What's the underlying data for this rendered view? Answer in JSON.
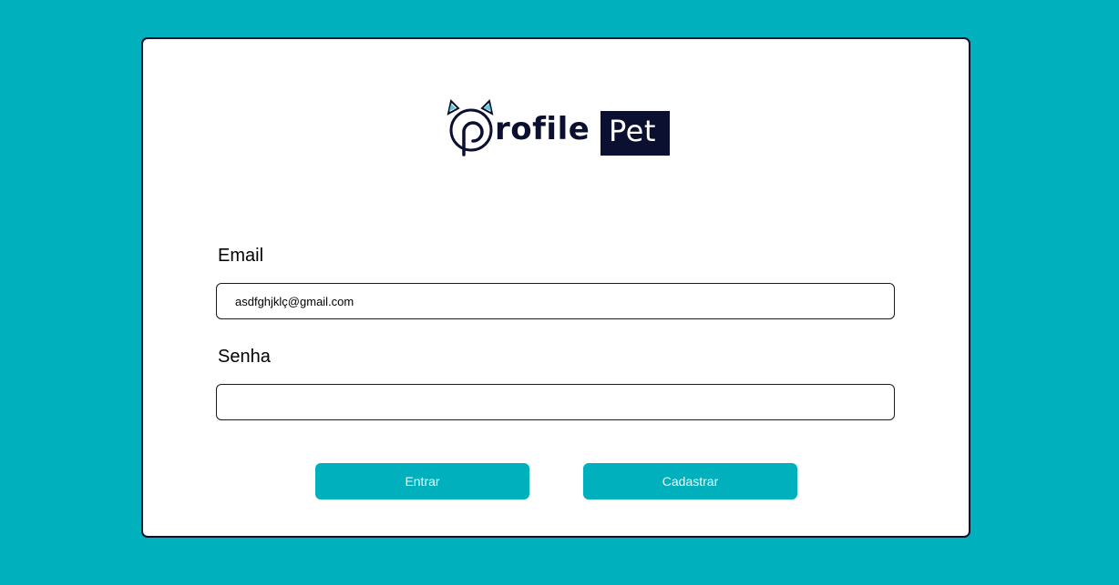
{
  "logo": {
    "word": "rofile",
    "box_text": "Pet"
  },
  "form": {
    "email_label": "Email",
    "email_value": "asdfghjklç@gmail.com",
    "password_label": "Senha",
    "password_value": ""
  },
  "buttons": {
    "login_label": "Entrar",
    "register_label": "Cadastrar"
  },
  "colors": {
    "background": "#00b0bc",
    "card": "#ffffff",
    "border": "#0b1030",
    "button": "#00b0bc"
  }
}
